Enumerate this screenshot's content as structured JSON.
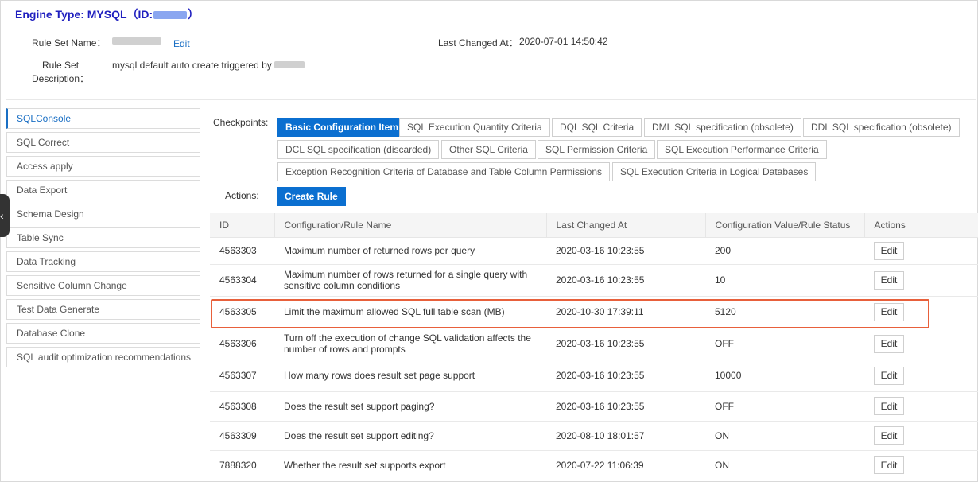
{
  "header": {
    "engine_prefix": "Engine Type: MYSQL（ID:",
    "engine_suffix": "）",
    "rule_set_name_label": "Rule Set Name：",
    "edit_link": "Edit",
    "last_changed_label": "Last Changed At：",
    "last_changed_value": "2020-07-01 14:50:42",
    "desc_label_line1": "Rule Set",
    "desc_label_line2": "Description：",
    "desc_value": "mysql default auto create triggered by"
  },
  "sidebar": {
    "items": [
      {
        "label": "SQLConsole",
        "active": true
      },
      {
        "label": "SQL Correct"
      },
      {
        "label": "Access apply"
      },
      {
        "label": "Data Export"
      },
      {
        "label": "Schema Design"
      },
      {
        "label": "Table Sync"
      },
      {
        "label": "Data Tracking"
      },
      {
        "label": "Sensitive Column Change"
      },
      {
        "label": "Test Data Generate"
      },
      {
        "label": "Database Clone"
      },
      {
        "label": "SQL audit optimization recommendations"
      }
    ],
    "collapse_glyph": "‹"
  },
  "checkpoints": {
    "label": "Checkpoints:",
    "chips": [
      "Basic Configuration Item",
      "SQL Execution Quantity Criteria",
      "DQL SQL Criteria",
      "DML SQL specification (obsolete)",
      "DDL SQL specification (obsolete)",
      "DCL SQL specification (discarded)",
      "Other SQL Criteria",
      "SQL Permission Criteria",
      "SQL Execution Performance Criteria",
      "Exception Recognition Criteria of Database and Table Column Permissions",
      "SQL Execution Criteria in Logical Databases"
    ]
  },
  "actions": {
    "label": "Actions:",
    "create_rule": "Create Rule"
  },
  "table": {
    "headers": [
      "ID",
      "Configuration/Rule Name",
      "Last Changed At",
      "Configuration Value/Rule Status",
      "Actions"
    ],
    "rows": [
      {
        "id": "4563303",
        "name": "Maximum number of returned rows per query",
        "changed": "2020-03-16 10:23:55",
        "value": "200",
        "action": "Edit"
      },
      {
        "id": "4563304",
        "name": "Maximum number of rows returned for a single query with sensitive column conditions",
        "changed": "2020-03-16 10:23:55",
        "value": "10",
        "action": "Edit"
      },
      {
        "id": "4563305",
        "name": "Limit the maximum allowed SQL full table scan (MB)",
        "changed": "2020-10-30 17:39:11",
        "value": "5120",
        "action": "Edit"
      },
      {
        "id": "4563306",
        "name": "Turn off the execution of change SQL validation affects the number of rows and prompts",
        "changed": "2020-03-16 10:23:55",
        "value": "OFF",
        "action": "Edit"
      },
      {
        "id": "4563307",
        "name": "How many rows does result set page support",
        "changed": "2020-03-16 10:23:55",
        "value": "10000",
        "action": "Edit"
      },
      {
        "id": "4563308",
        "name": "Does the result set support paging?",
        "changed": "2020-03-16 10:23:55",
        "value": "OFF",
        "action": "Edit"
      },
      {
        "id": "4563309",
        "name": "Does the result set support editing?",
        "changed": "2020-08-10 18:01:57",
        "value": "ON",
        "action": "Edit"
      },
      {
        "id": "7888320",
        "name": "Whether the result set supports export",
        "changed": "2020-07-22 11:06:39",
        "value": "ON",
        "action": "Edit"
      }
    ]
  },
  "colors": {
    "accent": "#0b6fd0",
    "engine_title": "#1f1fbf",
    "highlight": "#e8603b"
  }
}
